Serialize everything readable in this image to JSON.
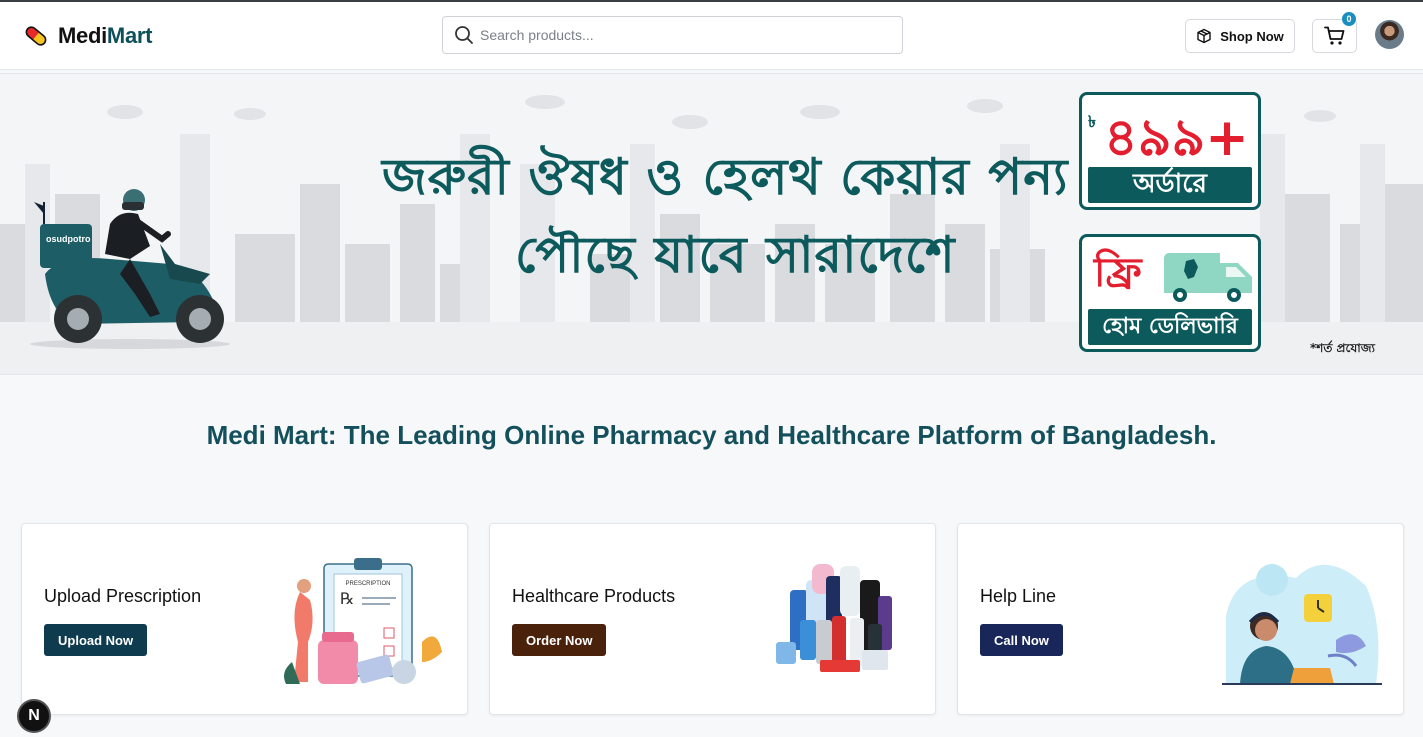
{
  "header": {
    "brand_prefix": "Medi",
    "brand_suffix": "Mart",
    "search_placeholder": "Search products...",
    "shop_button_label": "Shop Now",
    "cart_count": "0"
  },
  "banner": {
    "line1": "জরুরী ঔষধ ও হেলথ কেয়ার পন্য",
    "line2": "পৌছে যাবে সারাদেশে",
    "currency_symbol": "৳",
    "min_order_amount": "৪৯৯+",
    "min_order_label": "অর্ডারে",
    "free_label": "ফ্রি",
    "delivery_label": "হোম ডেলিভারি",
    "conditions": "*শর্ত প্রযোজ্য",
    "scooter_box_text": "osudpotro"
  },
  "headline": "Medi Mart: The Leading Online Pharmacy and Healthcare Platform of Bangladesh.",
  "cards": [
    {
      "title": "Upload Prescription",
      "button_label": "Upload Now",
      "button_color": "#0f3b4f",
      "illustration_text": "PRESCRIPTION"
    },
    {
      "title": "Healthcare Products",
      "button_label": "Order Now",
      "button_color": "#4a220c"
    },
    {
      "title": "Help Line",
      "button_label": "Call Now",
      "button_color": "#18265a"
    }
  ],
  "colors": {
    "brand_teal": "#0c5a5c",
    "headline": "#13505c",
    "badge": "#1a8fbf",
    "price_red": "#e31e2e"
  },
  "corner_badge": "N"
}
